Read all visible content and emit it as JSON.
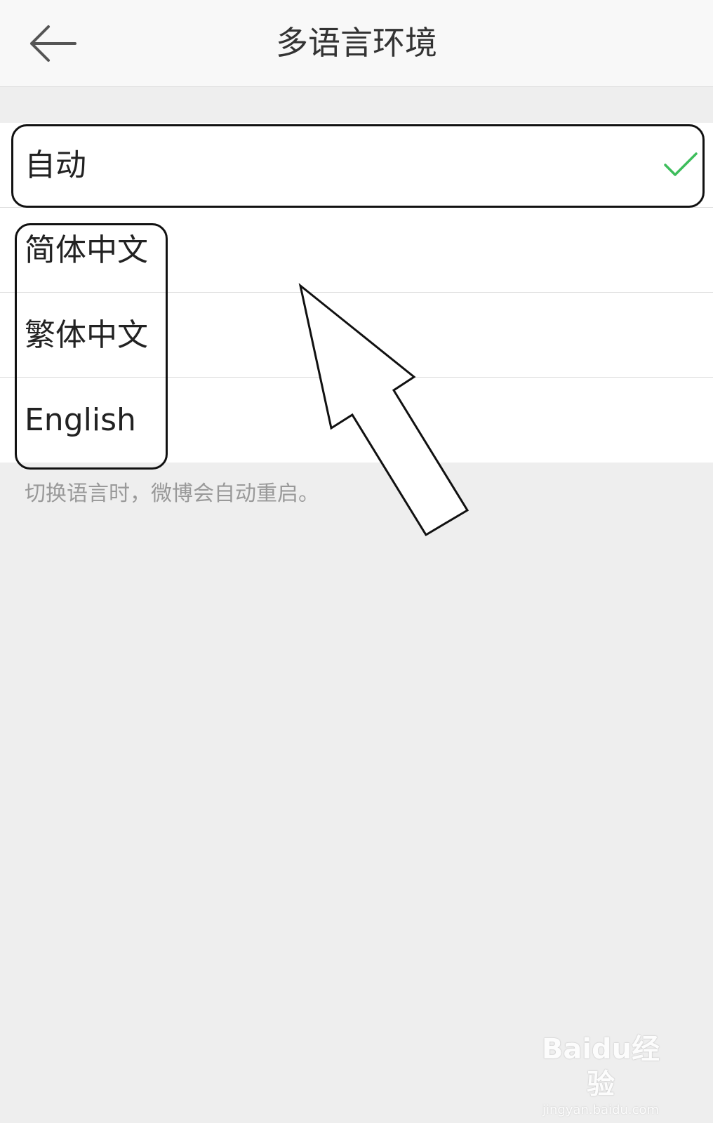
{
  "header": {
    "title": "多语言环境",
    "back_icon": "arrow-left-icon"
  },
  "languages": [
    {
      "label": "自动",
      "selected": true
    },
    {
      "label": "简体中文",
      "selected": false
    },
    {
      "label": "繁体中文",
      "selected": false
    },
    {
      "label": "English",
      "selected": false
    }
  ],
  "hint": "切换语言时，微博会自动重启。",
  "colors": {
    "check": "#3dbd5b",
    "background": "#eeeeee",
    "header_bg": "#f8f8f8"
  },
  "watermark": {
    "brand": "Baidu经验",
    "url": "jingyan.baidu.com"
  }
}
